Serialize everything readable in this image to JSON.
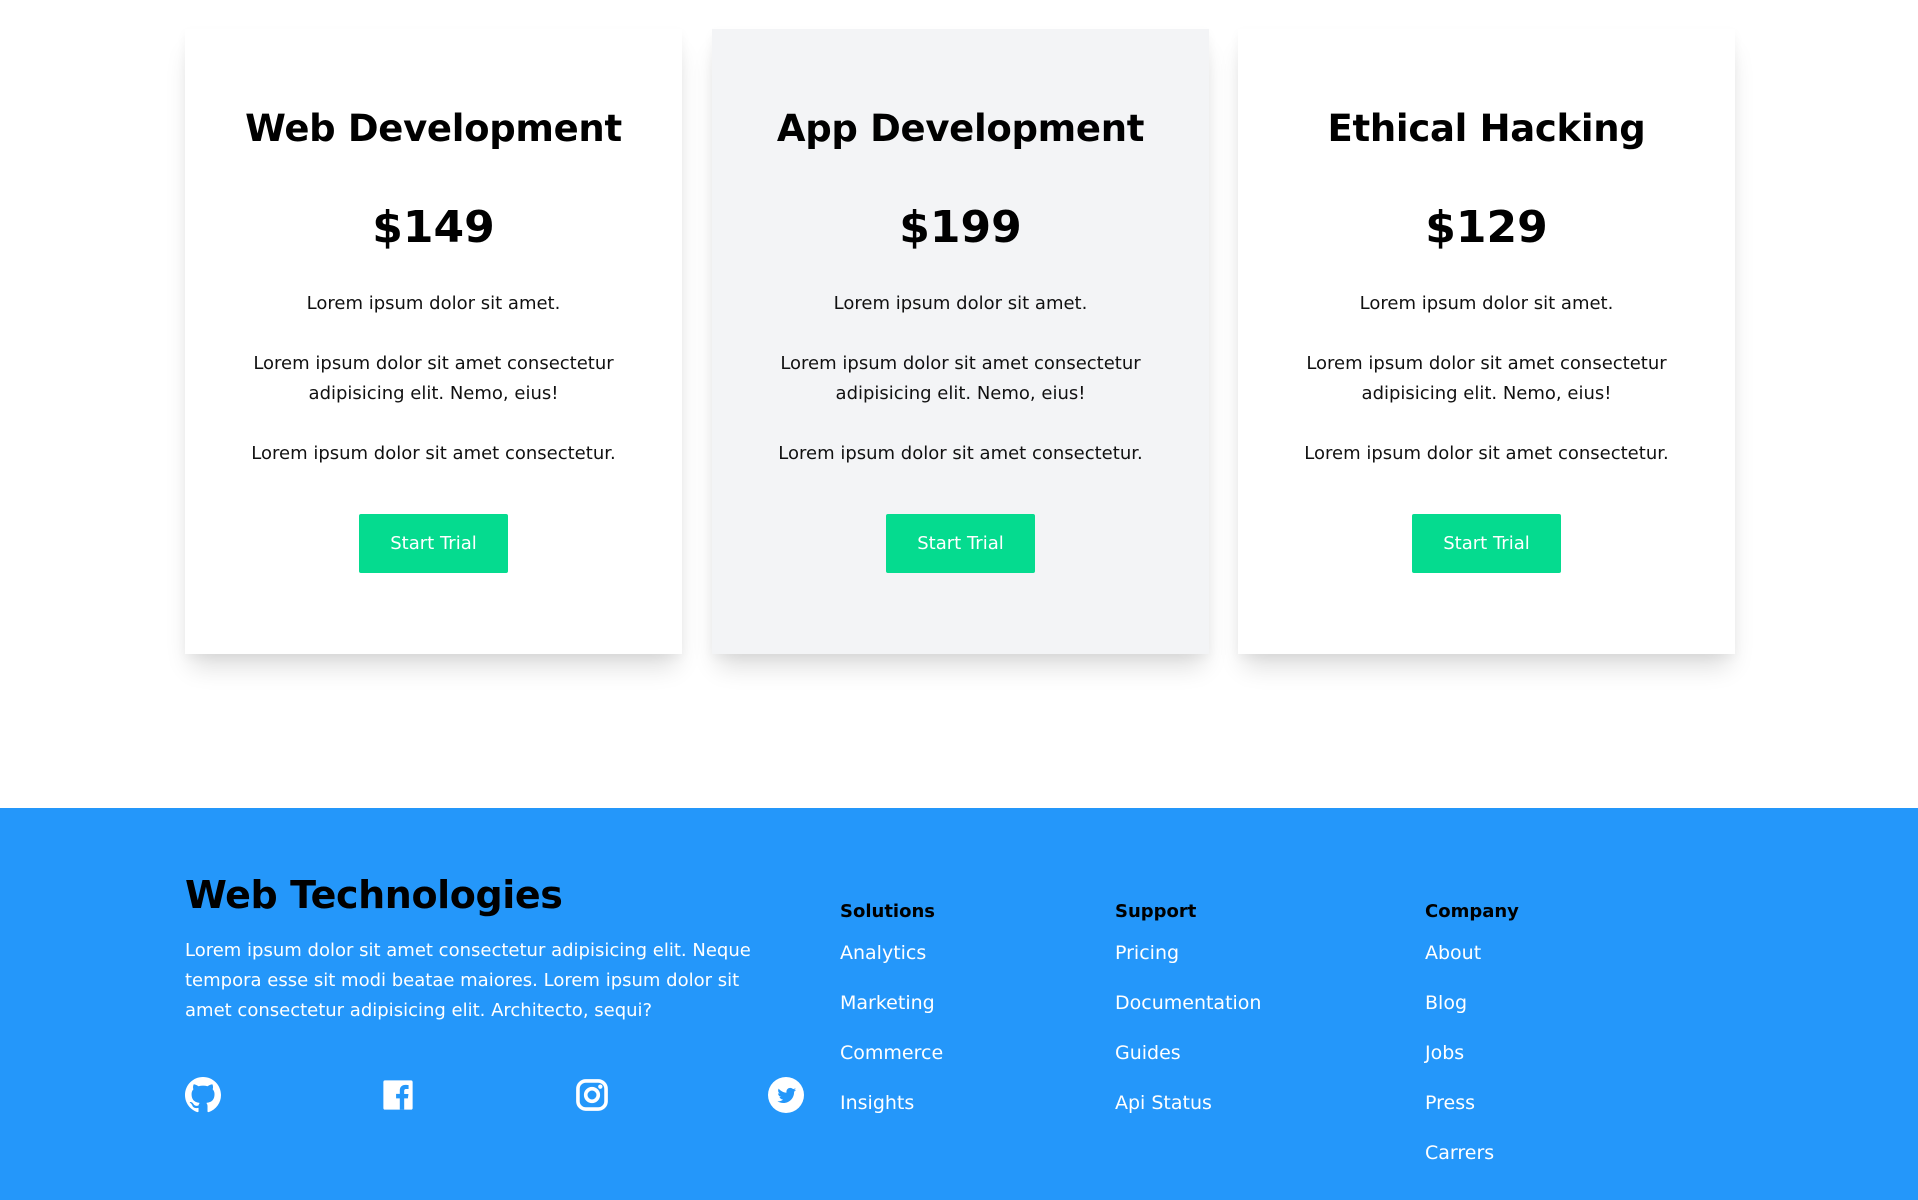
{
  "pricing": {
    "cards": [
      {
        "title": "Web Development",
        "price": "$149",
        "features": [
          "Lorem ipsum dolor sit amet.",
          "Lorem ipsum dolor sit amet consectetur adipisicing elit. Nemo, eius!",
          "Lorem ipsum dolor sit amet consectetur."
        ],
        "button_label": "Start Trial"
      },
      {
        "title": "App Development",
        "price": "$199",
        "features": [
          "Lorem ipsum dolor sit amet.",
          "Lorem ipsum dolor sit amet consectetur adipisicing elit. Nemo, eius!",
          "Lorem ipsum dolor sit amet consectetur."
        ],
        "button_label": "Start Trial"
      },
      {
        "title": "Ethical Hacking",
        "price": "$129",
        "features": [
          "Lorem ipsum dolor sit amet.",
          "Lorem ipsum dolor sit amet consectetur adipisicing elit. Nemo, eius!",
          "Lorem ipsum dolor sit amet consectetur."
        ],
        "button_label": "Start Trial"
      }
    ]
  },
  "footer": {
    "brand": "Web Technologies",
    "description": "Lorem ipsum dolor sit amet consectetur adipisicing elit. Neque tempora esse sit modi beatae maiores. Lorem ipsum dolor sit amet consectetur adipisicing elit. Architecto, sequi?",
    "social": [
      "github-icon",
      "facebook-icon",
      "instagram-icon",
      "twitter-icon"
    ],
    "columns": [
      {
        "title": "Solutions",
        "links": [
          "Analytics",
          "Marketing",
          "Commerce",
          "Insights"
        ]
      },
      {
        "title": "Support",
        "links": [
          "Pricing",
          "Documentation",
          "Guides",
          "Api Status"
        ]
      },
      {
        "title": "Company",
        "links": [
          "About",
          "Blog",
          "Jobs",
          "Press",
          "Carrers"
        ]
      }
    ]
  },
  "colors": {
    "accent_button": "#05db8f",
    "footer_background": "#2497fa",
    "featured_card_background": "#f3f4f6"
  }
}
